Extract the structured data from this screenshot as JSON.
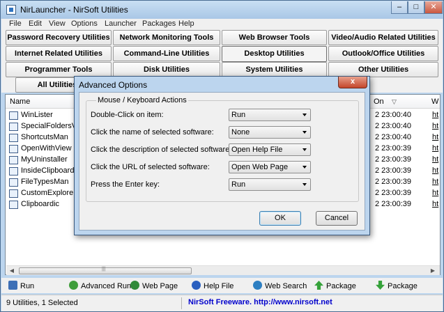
{
  "window": {
    "title": "NirLauncher  -  NirSoft Utilities"
  },
  "menu": [
    "File",
    "Edit",
    "View",
    "Options",
    "Launcher",
    "Packages",
    "Help"
  ],
  "categories": [
    "Password Recovery Utilities",
    "Network Monitoring Tools",
    "Web Browser Tools",
    "Video/Audio Related Utilities",
    "Internet Related Utilities",
    "Command-Line Utilities",
    "Desktop Utilities",
    "Outlook/Office Utilities",
    "Programmer Tools",
    "Disk Utilities",
    "System Utilities",
    "Other Utilities",
    "All Utilities"
  ],
  "list": {
    "columns": {
      "name": "Name",
      "on": "On",
      "w": "W"
    },
    "rows": [
      {
        "name": "WinLister",
        "date": "2 23:00:40",
        "url": "ht"
      },
      {
        "name": "SpecialFoldersView",
        "date": "2 23:00:40",
        "url": "ht"
      },
      {
        "name": "ShortcutsMan",
        "date": "2 23:00:40",
        "url": "ht"
      },
      {
        "name": "OpenWithView",
        "date": "2 23:00:39",
        "url": "ht"
      },
      {
        "name": "MyUninstaller",
        "date": "2 23:00:39",
        "url": "ht"
      },
      {
        "name": "InsideClipboard",
        "date": "2 23:00:39",
        "url": "ht"
      },
      {
        "name": "FileTypesMan",
        "date": "2 23:00:39",
        "url": "ht"
      },
      {
        "name": "CustomExplorerToolbar",
        "date": "2 23:00:39",
        "url": "ht"
      },
      {
        "name": "Clipboardic",
        "date": "2 23:00:39",
        "url": "ht"
      }
    ]
  },
  "toolbar": {
    "run": "Run",
    "advanced_run": "Advanced Run",
    "web_page": "Web Page",
    "help_file": "Help File",
    "web_search": "Web Search",
    "package_add": "Package",
    "package_remove": "Package"
  },
  "status": {
    "count": "9 Utilities, 1 Selected",
    "link": "NirSoft Freeware.  http://www.nirsoft.net"
  },
  "dialog": {
    "title": "Advanced Options",
    "close": "x",
    "group": "Mouse / Keyboard Actions",
    "options": [
      {
        "label": "Double-Click on item:",
        "value": "Run"
      },
      {
        "label": "Click the name of selected software:",
        "value": "None"
      },
      {
        "label": "Click the description of selected software:",
        "value": "Open Help File"
      },
      {
        "label": "Click the URL of selected software:",
        "value": "Open Web Page"
      },
      {
        "label": "Press the Enter key:",
        "value": "Run"
      }
    ],
    "ok": "OK",
    "cancel": "Cancel"
  },
  "colors": {
    "link": "#0000cc",
    "selected_button": "#3c7fb1",
    "close_button": "#c4462b"
  }
}
